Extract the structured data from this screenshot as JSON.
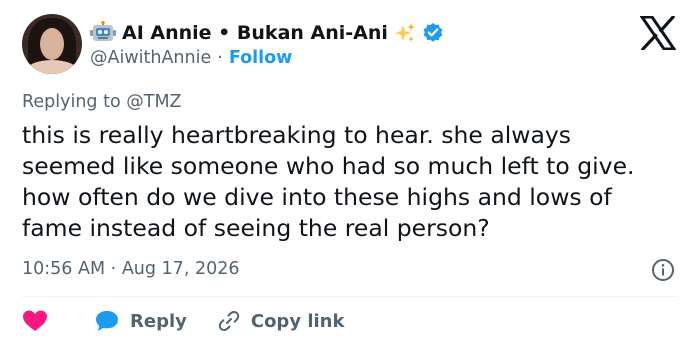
{
  "author": {
    "name": "AI Annie • Bukan Ani-Ani",
    "handle": "@AiwithAnnie",
    "separator": "·",
    "follow_label": "Follow"
  },
  "icons": {
    "name_emoji_left": "robot-icon",
    "name_emoji_right": "sparkle-icon",
    "verified": "verified-badge-icon",
    "brand": "x-logo-icon"
  },
  "tweet": {
    "replying_prefix": "Replying to",
    "replying_to": "@TMZ",
    "text": "this is really heartbreaking to hear. she always seemed like someone who had so much left to give. how often do we dive into these highs and lows of fame instead of seeing the real person?",
    "time": "10:56 AM",
    "date_separator": "·",
    "date": "Aug 17, 2026"
  },
  "actions": {
    "reply_label": "Reply",
    "copy_link_label": "Copy link"
  },
  "colors": {
    "accent": "#1d9bf0",
    "like": "#f91880",
    "text": "#0f1419",
    "muted": "#536471"
  }
}
